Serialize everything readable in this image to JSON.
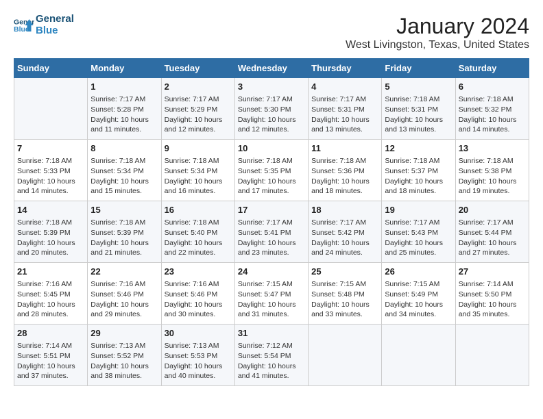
{
  "header": {
    "logo_line1": "General",
    "logo_line2": "Blue",
    "main_title": "January 2024",
    "subtitle": "West Livingston, Texas, United States"
  },
  "days_of_week": [
    "Sunday",
    "Monday",
    "Tuesday",
    "Wednesday",
    "Thursday",
    "Friday",
    "Saturday"
  ],
  "weeks": [
    [
      {
        "day": "",
        "info": ""
      },
      {
        "day": "1",
        "info": "Sunrise: 7:17 AM\nSunset: 5:28 PM\nDaylight: 10 hours\nand 11 minutes."
      },
      {
        "day": "2",
        "info": "Sunrise: 7:17 AM\nSunset: 5:29 PM\nDaylight: 10 hours\nand 12 minutes."
      },
      {
        "day": "3",
        "info": "Sunrise: 7:17 AM\nSunset: 5:30 PM\nDaylight: 10 hours\nand 12 minutes."
      },
      {
        "day": "4",
        "info": "Sunrise: 7:17 AM\nSunset: 5:31 PM\nDaylight: 10 hours\nand 13 minutes."
      },
      {
        "day": "5",
        "info": "Sunrise: 7:18 AM\nSunset: 5:31 PM\nDaylight: 10 hours\nand 13 minutes."
      },
      {
        "day": "6",
        "info": "Sunrise: 7:18 AM\nSunset: 5:32 PM\nDaylight: 10 hours\nand 14 minutes."
      }
    ],
    [
      {
        "day": "7",
        "info": "Sunrise: 7:18 AM\nSunset: 5:33 PM\nDaylight: 10 hours\nand 14 minutes."
      },
      {
        "day": "8",
        "info": "Sunrise: 7:18 AM\nSunset: 5:34 PM\nDaylight: 10 hours\nand 15 minutes."
      },
      {
        "day": "9",
        "info": "Sunrise: 7:18 AM\nSunset: 5:34 PM\nDaylight: 10 hours\nand 16 minutes."
      },
      {
        "day": "10",
        "info": "Sunrise: 7:18 AM\nSunset: 5:35 PM\nDaylight: 10 hours\nand 17 minutes."
      },
      {
        "day": "11",
        "info": "Sunrise: 7:18 AM\nSunset: 5:36 PM\nDaylight: 10 hours\nand 18 minutes."
      },
      {
        "day": "12",
        "info": "Sunrise: 7:18 AM\nSunset: 5:37 PM\nDaylight: 10 hours\nand 18 minutes."
      },
      {
        "day": "13",
        "info": "Sunrise: 7:18 AM\nSunset: 5:38 PM\nDaylight: 10 hours\nand 19 minutes."
      }
    ],
    [
      {
        "day": "14",
        "info": "Sunrise: 7:18 AM\nSunset: 5:39 PM\nDaylight: 10 hours\nand 20 minutes."
      },
      {
        "day": "15",
        "info": "Sunrise: 7:18 AM\nSunset: 5:39 PM\nDaylight: 10 hours\nand 21 minutes."
      },
      {
        "day": "16",
        "info": "Sunrise: 7:18 AM\nSunset: 5:40 PM\nDaylight: 10 hours\nand 22 minutes."
      },
      {
        "day": "17",
        "info": "Sunrise: 7:17 AM\nSunset: 5:41 PM\nDaylight: 10 hours\nand 23 minutes."
      },
      {
        "day": "18",
        "info": "Sunrise: 7:17 AM\nSunset: 5:42 PM\nDaylight: 10 hours\nand 24 minutes."
      },
      {
        "day": "19",
        "info": "Sunrise: 7:17 AM\nSunset: 5:43 PM\nDaylight: 10 hours\nand 25 minutes."
      },
      {
        "day": "20",
        "info": "Sunrise: 7:17 AM\nSunset: 5:44 PM\nDaylight: 10 hours\nand 27 minutes."
      }
    ],
    [
      {
        "day": "21",
        "info": "Sunrise: 7:16 AM\nSunset: 5:45 PM\nDaylight: 10 hours\nand 28 minutes."
      },
      {
        "day": "22",
        "info": "Sunrise: 7:16 AM\nSunset: 5:46 PM\nDaylight: 10 hours\nand 29 minutes."
      },
      {
        "day": "23",
        "info": "Sunrise: 7:16 AM\nSunset: 5:46 PM\nDaylight: 10 hours\nand 30 minutes."
      },
      {
        "day": "24",
        "info": "Sunrise: 7:15 AM\nSunset: 5:47 PM\nDaylight: 10 hours\nand 31 minutes."
      },
      {
        "day": "25",
        "info": "Sunrise: 7:15 AM\nSunset: 5:48 PM\nDaylight: 10 hours\nand 33 minutes."
      },
      {
        "day": "26",
        "info": "Sunrise: 7:15 AM\nSunset: 5:49 PM\nDaylight: 10 hours\nand 34 minutes."
      },
      {
        "day": "27",
        "info": "Sunrise: 7:14 AM\nSunset: 5:50 PM\nDaylight: 10 hours\nand 35 minutes."
      }
    ],
    [
      {
        "day": "28",
        "info": "Sunrise: 7:14 AM\nSunset: 5:51 PM\nDaylight: 10 hours\nand 37 minutes."
      },
      {
        "day": "29",
        "info": "Sunrise: 7:13 AM\nSunset: 5:52 PM\nDaylight: 10 hours\nand 38 minutes."
      },
      {
        "day": "30",
        "info": "Sunrise: 7:13 AM\nSunset: 5:53 PM\nDaylight: 10 hours\nand 40 minutes."
      },
      {
        "day": "31",
        "info": "Sunrise: 7:12 AM\nSunset: 5:54 PM\nDaylight: 10 hours\nand 41 minutes."
      },
      {
        "day": "",
        "info": ""
      },
      {
        "day": "",
        "info": ""
      },
      {
        "day": "",
        "info": ""
      }
    ]
  ]
}
